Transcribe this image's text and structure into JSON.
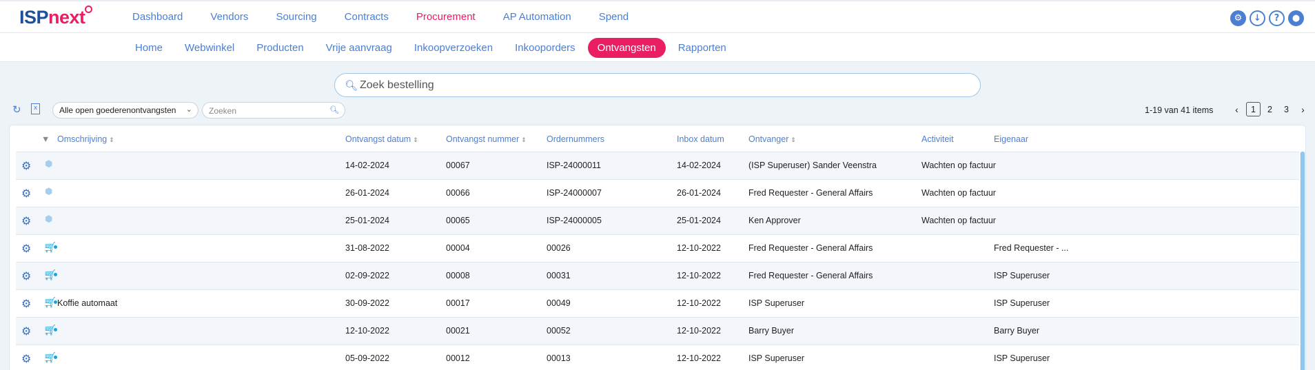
{
  "app": {
    "logo_main": "ISP",
    "logo_accent": "next"
  },
  "top_nav": [
    {
      "label": "Dashboard",
      "active": false
    },
    {
      "label": "Vendors",
      "active": false
    },
    {
      "label": "Sourcing",
      "active": false
    },
    {
      "label": "Contracts",
      "active": false
    },
    {
      "label": "Procurement",
      "active": true
    },
    {
      "label": "AP Automation",
      "active": false
    },
    {
      "label": "Spend",
      "active": false
    }
  ],
  "top_icons": [
    "settings-icon",
    "download-icon",
    "help-icon",
    "user-icon"
  ],
  "sub_nav": [
    {
      "label": "Home",
      "active": false
    },
    {
      "label": "Webwinkel",
      "active": false
    },
    {
      "label": "Producten",
      "active": false
    },
    {
      "label": "Vrije aanvraag",
      "active": false
    },
    {
      "label": "Inkoopverzoeken",
      "active": false
    },
    {
      "label": "Inkooporders",
      "active": false
    },
    {
      "label": "Ontvangsten",
      "active": true
    },
    {
      "label": "Rapporten",
      "active": false
    }
  ],
  "search": {
    "placeholder": "Zoek bestelling"
  },
  "toolbar": {
    "filter_value": "Alle open goederenontvangsten",
    "search_placeholder": "Zoeken",
    "pager_info": "1-19 van 41 items",
    "pages": [
      "1",
      "2",
      "3"
    ],
    "current_page": "1"
  },
  "table": {
    "columns": [
      {
        "key": "omschrijving",
        "label": "Omschrijving",
        "sortable": true
      },
      {
        "key": "datum",
        "label": "Ontvangst datum",
        "sortable": true
      },
      {
        "key": "nummer",
        "label": "Ontvangst nummer",
        "sortable": true
      },
      {
        "key": "orders",
        "label": "Ordernummers",
        "sortable": false
      },
      {
        "key": "inbox",
        "label": "Inbox datum",
        "sortable": false
      },
      {
        "key": "ontvanger",
        "label": "Ontvanger",
        "sortable": true
      },
      {
        "key": "activiteit",
        "label": "Activiteit",
        "sortable": false
      },
      {
        "key": "eigenaar",
        "label": "Eigenaar",
        "sortable": false
      }
    ],
    "rows": [
      {
        "icon": "cube",
        "omschrijving": "",
        "datum": "14-02-2024",
        "nummer": "00067",
        "orders": "ISP-24000011",
        "inbox": "14-02-2024",
        "ontvanger": "(ISP Superuser) Sander Veenstra",
        "activiteit": "Wachten op factuur",
        "eigenaar": ""
      },
      {
        "icon": "cube",
        "omschrijving": "",
        "datum": "26-01-2024",
        "nummer": "00066",
        "orders": "ISP-24000007",
        "inbox": "26-01-2024",
        "ontvanger": "Fred Requester - General Affairs",
        "activiteit": "Wachten op factuur",
        "eigenaar": ""
      },
      {
        "icon": "cube",
        "omschrijving": "",
        "datum": "25-01-2024",
        "nummer": "00065",
        "orders": "ISP-24000005",
        "inbox": "25-01-2024",
        "ontvanger": "Ken Approver",
        "activiteit": "Wachten op factuur",
        "eigenaar": ""
      },
      {
        "icon": "cart",
        "omschrijving": "",
        "datum": "31-08-2022",
        "nummer": "00004",
        "orders": "00026",
        "inbox": "12-10-2022",
        "ontvanger": "Fred Requester - General Affairs",
        "activiteit": "",
        "eigenaar": "Fred Requester - ..."
      },
      {
        "icon": "cart",
        "omschrijving": "",
        "datum": "02-09-2022",
        "nummer": "00008",
        "orders": "00031",
        "inbox": "12-10-2022",
        "ontvanger": "Fred Requester - General Affairs",
        "activiteit": "",
        "eigenaar": "ISP Superuser"
      },
      {
        "icon": "cart",
        "omschrijving": "Koffie automaat",
        "datum": "30-09-2022",
        "nummer": "00017",
        "orders": "00049",
        "inbox": "12-10-2022",
        "ontvanger": "ISP Superuser",
        "activiteit": "",
        "eigenaar": "ISP Superuser"
      },
      {
        "icon": "cart",
        "omschrijving": "",
        "datum": "12-10-2022",
        "nummer": "00021",
        "orders": "00052",
        "inbox": "12-10-2022",
        "ontvanger": "Barry Buyer",
        "activiteit": "",
        "eigenaar": "Barry Buyer"
      },
      {
        "icon": "cart",
        "omschrijving": "",
        "datum": "05-09-2022",
        "nummer": "00012",
        "orders": "00013",
        "inbox": "12-10-2022",
        "ontvanger": "ISP Superuser",
        "activiteit": "",
        "eigenaar": "ISP Superuser"
      }
    ]
  }
}
